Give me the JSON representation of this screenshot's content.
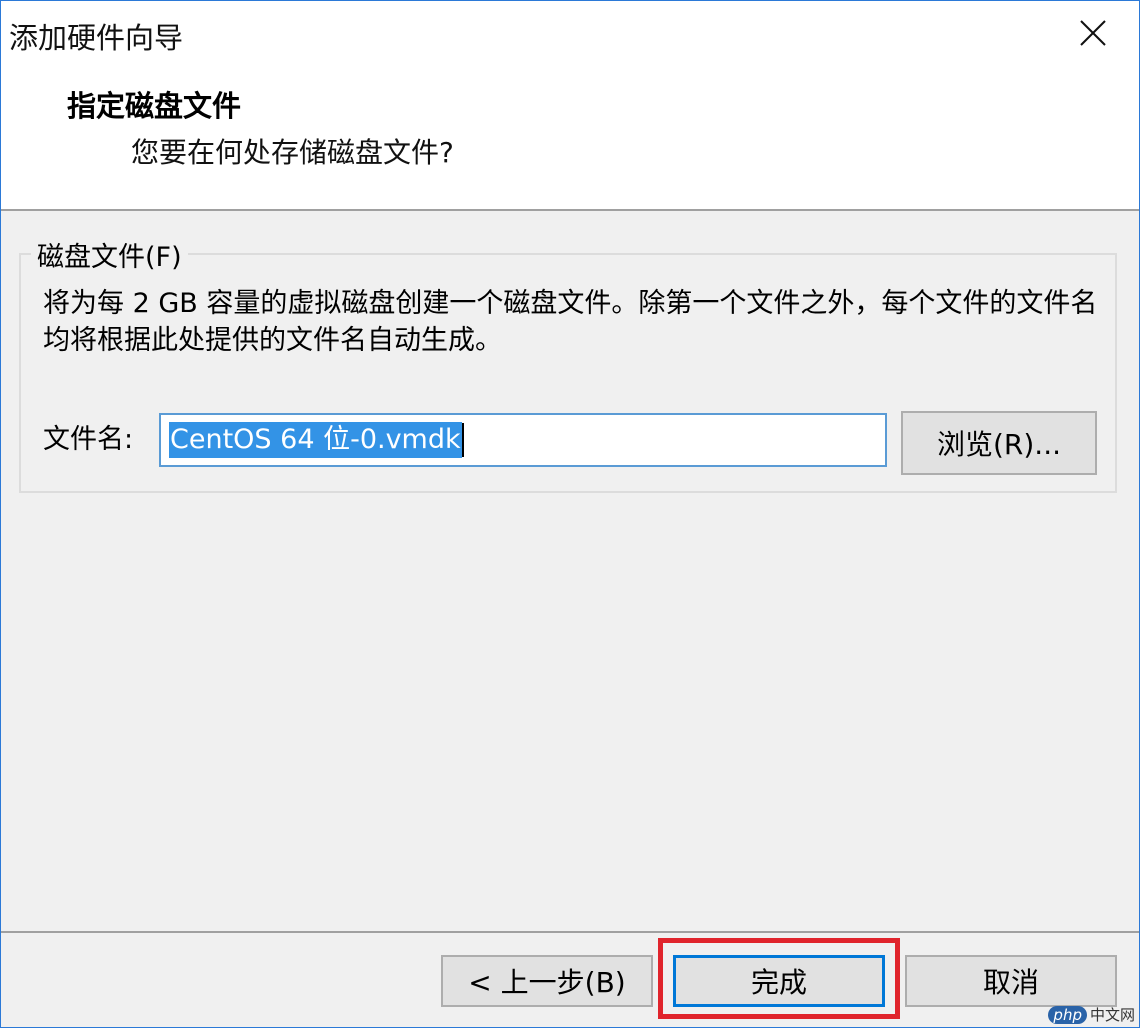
{
  "window": {
    "title": "添加硬件向导"
  },
  "header": {
    "title": "指定磁盘文件",
    "subtitle": "您要在何处存储磁盘文件?"
  },
  "disk_group": {
    "legend": "磁盘文件(F)",
    "description": "将为每 2 GB 容量的虚拟磁盘创建一个磁盘文件。除第一个文件之外，每个文件的文件名均将根据此处提供的文件名自动生成。",
    "filename_label": "文件名:",
    "filename_value": "CentOS 64 位-0.vmdk",
    "browse_label": "浏览(R)..."
  },
  "footer": {
    "back_label": "< 上一步(B)",
    "finish_label": "完成",
    "cancel_label": "取消"
  },
  "watermark": {
    "logo": "php",
    "text": "中文网"
  },
  "colors": {
    "accent": "#0078d7",
    "selection": "#3393e6",
    "highlight": "#e0242c"
  }
}
